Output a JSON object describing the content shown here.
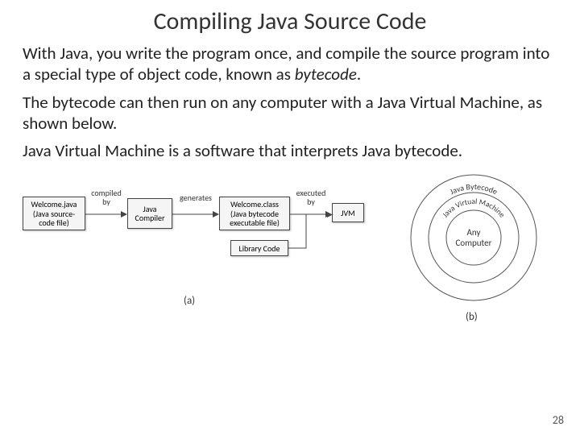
{
  "title": "Compiling Java Source Code",
  "paragraphs": {
    "p1a": "With Java, you write the program once, and compile the source program into a special type of object code, known as ",
    "p1b": "bytecode",
    "p1c": ".",
    "p2": "The bytecode can then run on any computer with a Java Virtual Machine, as shown below.",
    "p3": "Java Virtual Machine is a software that interprets Java bytecode."
  },
  "diagram": {
    "box1": "Welcome.java\n(Java source-\ncode file)",
    "label1": "compiled\nby",
    "box2": "Java\nCompiler",
    "label2": "generates",
    "box3": "Welcome.class\n(Java bytecode\nexecutable file)",
    "label3": "executed\nby",
    "box4": "JVM",
    "box5": "Library Code",
    "ring_outer": "Java Bytecode",
    "ring_mid": "Java Virtual Machine",
    "ring_inner": "Any\nComputer",
    "sub_a": "(a)",
    "sub_b": "(b)",
    "page": "28"
  }
}
